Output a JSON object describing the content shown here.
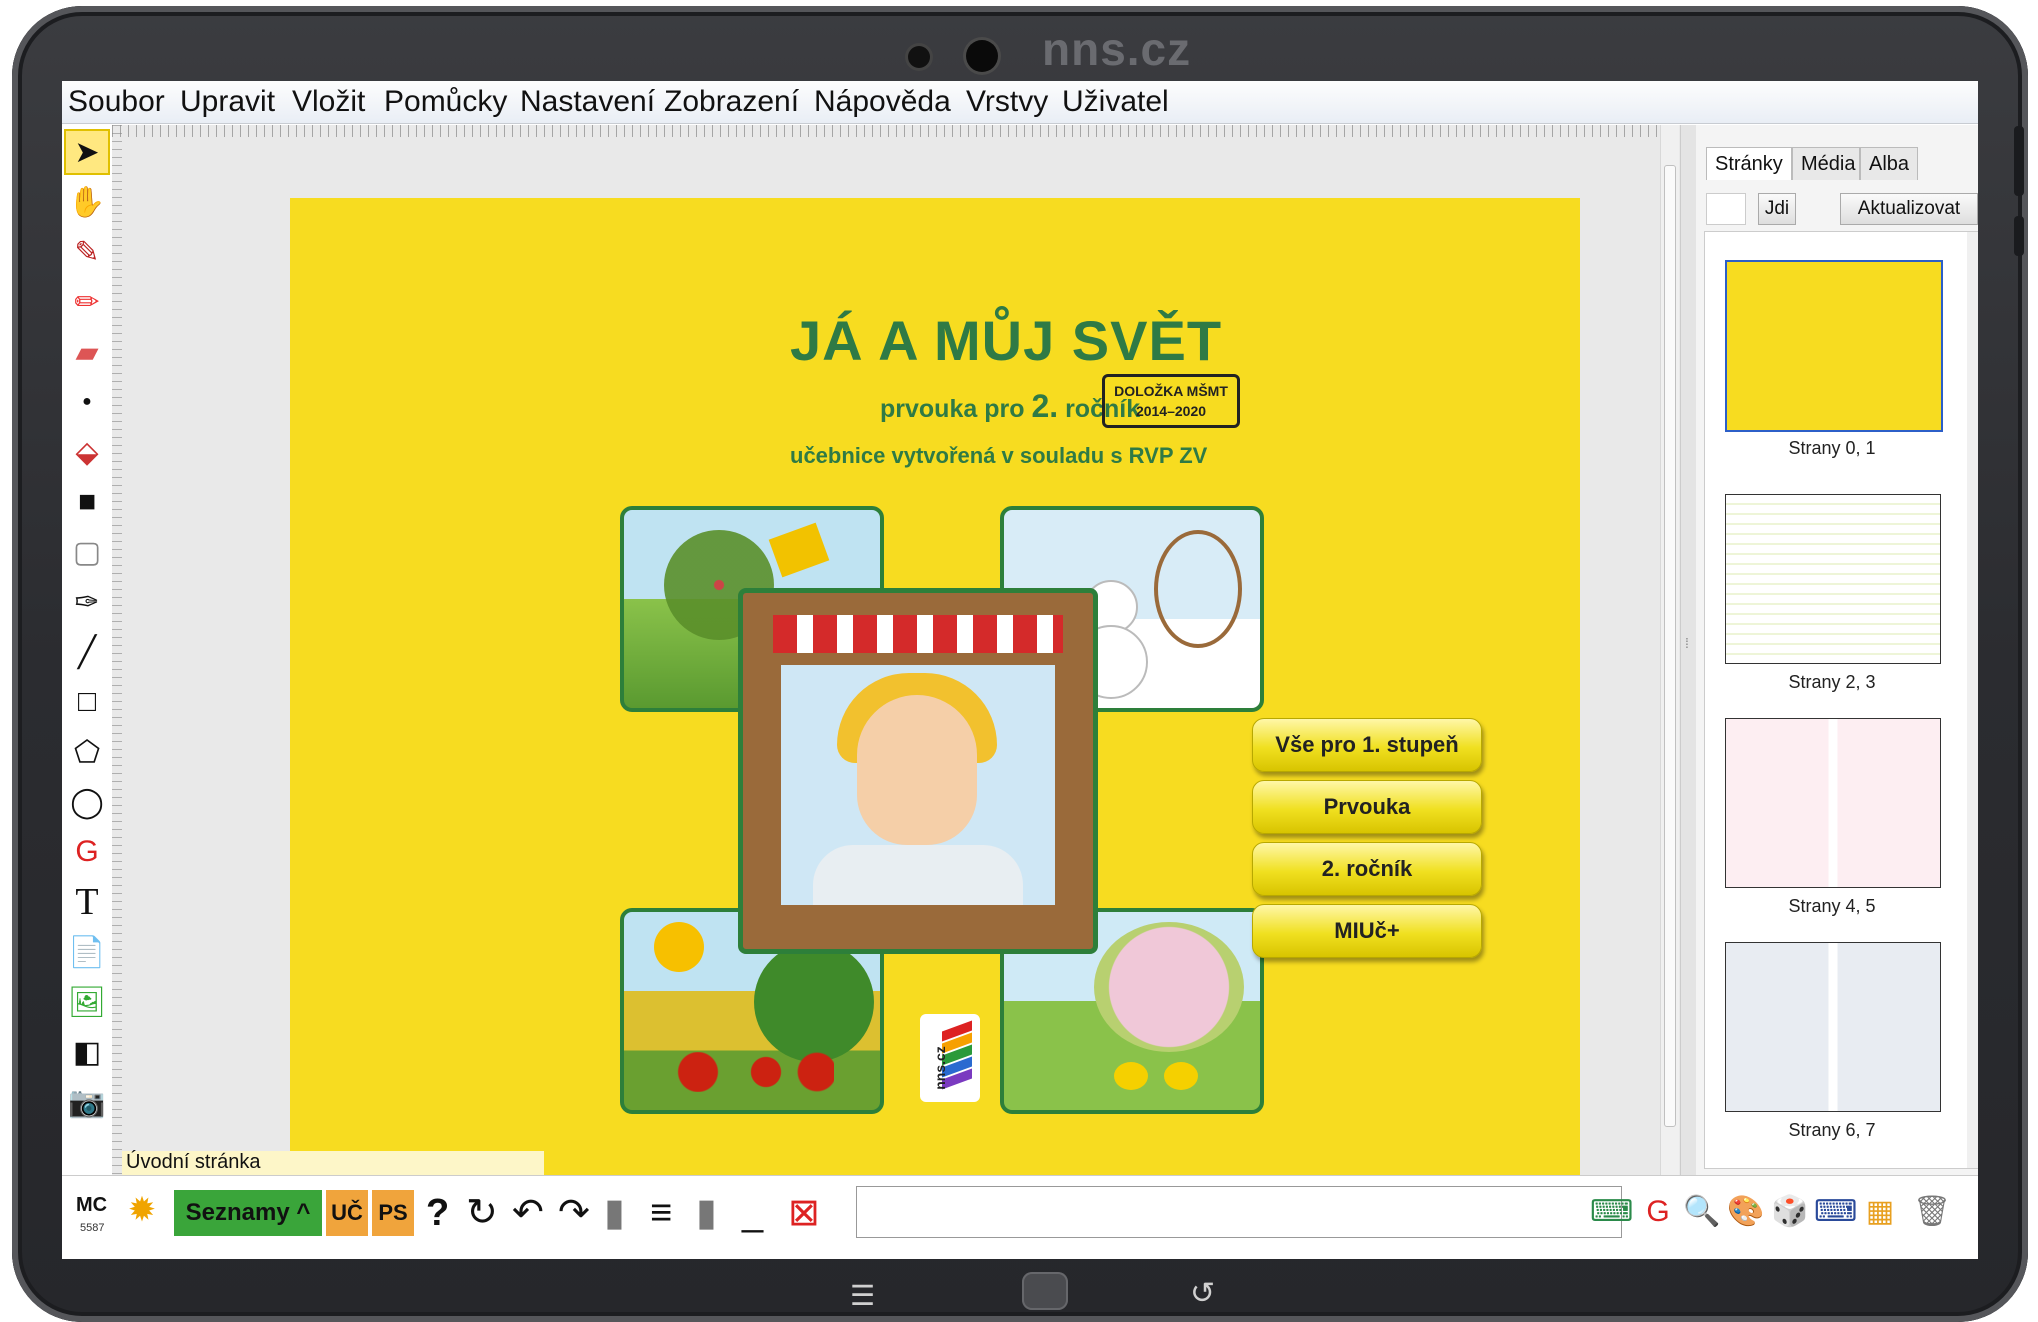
{
  "device": {
    "brand": "nns.cz"
  },
  "menu": [
    "Soubor",
    "Upravit",
    "Vložit",
    "Pomůcky",
    "Nastavení",
    "Zobrazení",
    "Nápověda",
    "Vrstvy",
    "Uživatel"
  ],
  "tools": [
    "pointer-icon",
    "hand-icon",
    "pen-icon",
    "highlighter-icon",
    "eraser-icon",
    "dot-icon",
    "fill-bucket-icon",
    "filled-square-icon",
    "frame-square-icon",
    "eyedropper-icon",
    "line-icon",
    "rectangle-icon",
    "polygon-icon",
    "ellipse-icon",
    "geogebra-icon",
    "text-icon",
    "add-page-icon",
    "add-image-icon",
    "ic-icon",
    "camera-icon"
  ],
  "tool_glyphs": {
    "g": "G",
    "t": "T"
  },
  "page": {
    "label": "Úvodní stránka",
    "title": "JÁ A MŮJ SVĚT",
    "subtitle_pre": "prvouka pro",
    "subtitle_num": "2.",
    "subtitle_post": "ročník",
    "stamp_line1": "DOLOŽKA MŠMT",
    "stamp_line2": "2014–2020",
    "subtitle2": "učebnice vytvořená v souladu s RVP ZV",
    "links": [
      "Vše pro 1. stupeň",
      "Prvouka",
      "2. ročník",
      "MIUč+"
    ],
    "logo_text": "nns.cz",
    "background_color": "#f7dc20",
    "accent_green": "#2f7a45"
  },
  "panel": {
    "tabs": [
      "Stránky",
      "Média",
      "Alba"
    ],
    "go_button": "Jdi",
    "refresh_button": "Aktualizovat",
    "thumbnails": [
      "Strany 0, 1",
      "Strany 2, 3",
      "Strany 4, 5",
      "Strany 6, 7"
    ]
  },
  "bottombar": {
    "mc": "MC",
    "mc_number": "5587",
    "seznamy": "Seznamy ^",
    "uc": "UČ",
    "ps": "PS",
    "help": "?",
    "right_icons": [
      "keyboard-screen-icon",
      "geogebra-icon",
      "search-zoom-icon",
      "palette-icon",
      "dice-icon",
      "keyboard-icon",
      "calculator-icon",
      "trash-icon"
    ]
  }
}
